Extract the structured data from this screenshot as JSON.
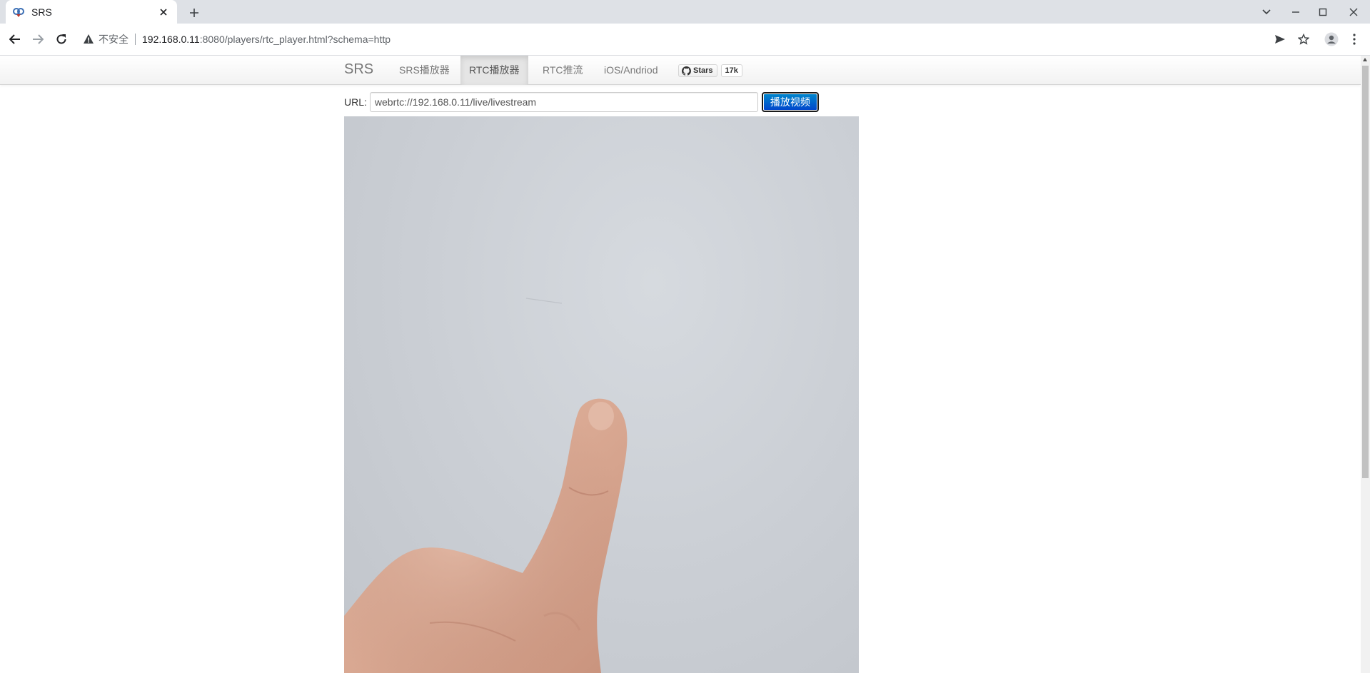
{
  "browser": {
    "tab_title": "SRS",
    "address": {
      "security_label": "不安全",
      "host": "192.168.0.11",
      "rest": ":8080/players/rtc_player.html?schema=http"
    }
  },
  "page": {
    "brand": "SRS",
    "nav": [
      {
        "label": "SRS播放器",
        "active": false
      },
      {
        "label": "RTC播放器",
        "active": true
      },
      {
        "label": "RTC推流",
        "active": false
      },
      {
        "label": "iOS/Andriod",
        "active": false
      }
    ],
    "github": {
      "stars_label": "Stars",
      "count": "17k"
    },
    "url_label": "URL:",
    "url_value": "webrtc://192.168.0.11/live/livestream",
    "play_button": "播放视频"
  },
  "colors": {
    "play_button": "#0044cc",
    "navbar_active": "#e5e5e5",
    "video_background": "#cbcfd5"
  }
}
